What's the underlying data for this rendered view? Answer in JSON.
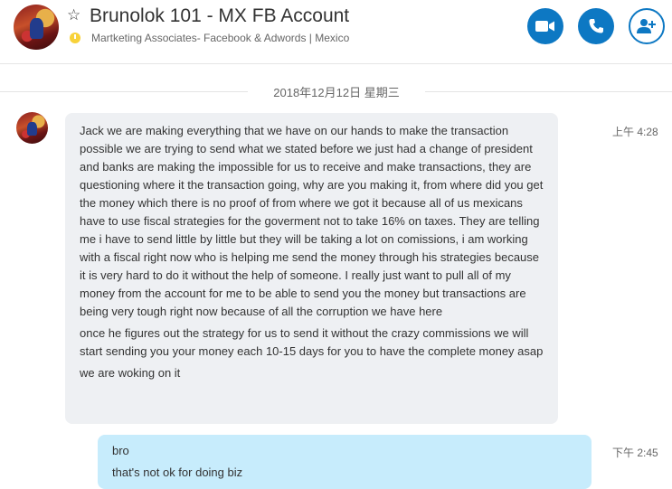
{
  "header": {
    "title": "Brunolok 101 - MX FB Account",
    "subtitle": "Martketing Associates- Facebook & Adwords | Mexico",
    "buttons": [
      "video-call",
      "audio-call",
      "add-people"
    ]
  },
  "conversation": {
    "date_separator": "2018年12月12日 星期三",
    "incoming": {
      "time": "上午 4:28",
      "paragraphs": [
        "Jack we are making everything that we have on our hands to make the transaction possible we are trying to send what we stated before we just had a change of president and banks are making the impossible for us to receive and make transactions, they are questioning where it the transaction going, why are you making it, from where did you get the money which there is no proof of from where we got it because all of us mexicans have to use fiscal strategies for the goverment not to take 16% on taxes. They are telling me i have to send little by little but they will be taking a lot on comissions, i am working with a fiscal right now who is helping me send the money through his strategies because it is very hard to do it without the help of someone. I really just want to pull all of my money from the account for me to be able to send you the money but transactions are being very tough right now because of all the corruption we have here",
        "once he figures out the strategy for us to send it without the crazy commissions we will start sending you your money each 10-15 days for you to have the complete money asap",
        "we are woking on it"
      ]
    },
    "outgoing": {
      "time": "下午 2:45",
      "paragraphs": [
        "bro",
        "that's not ok for doing biz"
      ]
    }
  },
  "colors": {
    "accent": "#0d78c3",
    "incoming_bubble": "#eef0f3",
    "outgoing_bubble": "#c7ecfc",
    "status": "#f8d23a"
  }
}
